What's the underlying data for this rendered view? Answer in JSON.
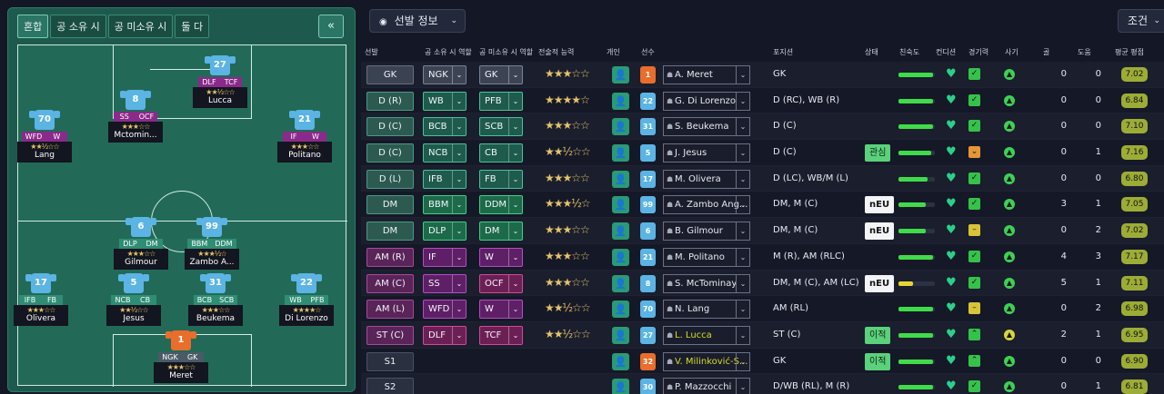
{
  "pitch_panel": {
    "tabs": [
      "혼합",
      "공 소유 시",
      "공 미소유 시",
      "둘 다"
    ],
    "collapse_label": "«",
    "players": [
      {
        "name": "Lucca",
        "number": "27",
        "roles": [
          "DLF",
          "TCF"
        ],
        "stars": "★★½☆☆",
        "gk": false
      },
      {
        "name": "Mctomin...",
        "number": "8",
        "roles": [
          "SS",
          "OCF"
        ],
        "stars": "★★★☆☆",
        "gk": false
      },
      {
        "name": "Lang",
        "number": "70",
        "roles": [
          "WFD",
          "W"
        ],
        "stars": "★★½☆☆",
        "gk": false
      },
      {
        "name": "Politano",
        "number": "21",
        "roles": [
          "IF",
          "W"
        ],
        "stars": "★★★☆☆",
        "gk": false
      },
      {
        "name": "Gilmour",
        "number": "6",
        "roles": [
          "DLP",
          "DM"
        ],
        "stars": "★★★☆☆",
        "gk": false
      },
      {
        "name": "Zambo A...",
        "number": "99",
        "roles": [
          "BBM",
          "DDM"
        ],
        "stars": "★★★½☆",
        "gk": false
      },
      {
        "name": "Olivera",
        "number": "17",
        "roles": [
          "IFB",
          "FB"
        ],
        "stars": "★★★☆☆",
        "gk": false
      },
      {
        "name": "Jesus",
        "number": "5",
        "roles": [
          "NCB",
          "CB"
        ],
        "stars": "★★½☆☆",
        "gk": false
      },
      {
        "name": "Beukema",
        "number": "31",
        "roles": [
          "BCB",
          "SCB"
        ],
        "stars": "★★★☆☆",
        "gk": false
      },
      {
        "name": "Di Lorenzo",
        "number": "22",
        "roles": [
          "WB",
          "PFB"
        ],
        "stars": "★★★★☆",
        "gk": false
      },
      {
        "name": "Meret",
        "number": "1",
        "roles": [
          "NGK",
          "GK"
        ],
        "stars": "★★★☆☆",
        "gk": true
      }
    ]
  },
  "table_panel": {
    "view_select": "선발 정보",
    "view_icon": "eye-icon",
    "filter_select": "조건",
    "headers": {
      "starting": "선발",
      "in_possession": "공 소유 시 역할",
      "out_possession": "공 미소유 시 역할",
      "tactical_ability": "전술적 능력",
      "individual": "개인",
      "player": "선수",
      "position": "포지션",
      "status": "상태",
      "familiarity": "친숙도",
      "condition": "컨디션",
      "match_sharpness": "경기력",
      "morale": "사기",
      "goals": "골",
      "assists": "도움",
      "avg_rating": "평균 평점"
    },
    "rows": [
      {
        "slot": "GK",
        "group": "gk",
        "r1": "NGK",
        "r1c": "gr",
        "r2": "GK",
        "r2c": "gr",
        "stars": "★★★☆☆",
        "num": "1",
        "gk": true,
        "player": "A. Meret",
        "hl": false,
        "position": "GK",
        "status": "",
        "sc": "",
        "fam": 0.95,
        "famc": "g",
        "sharp": "ok",
        "morale": "g",
        "goals": "0",
        "assists": "0",
        "rating": "7.02"
      },
      {
        "slot": "D (R)",
        "group": "def",
        "r1": "WB",
        "r1c": "tl",
        "r2": "PFB",
        "r2c": "tl",
        "stars": "★★★★☆",
        "num": "22",
        "gk": false,
        "player": "G. Di Lorenzo",
        "hl": false,
        "position": "D (RC), WB (R)",
        "status": "",
        "sc": "",
        "fam": 0.95,
        "famc": "g",
        "sharp": "ok",
        "morale": "g",
        "goals": "0",
        "assists": "0",
        "rating": "6.84"
      },
      {
        "slot": "D (C)",
        "group": "def",
        "r1": "BCB",
        "r1c": "tl",
        "r2": "SCB",
        "r2c": "tl",
        "stars": "★★★☆☆",
        "num": "31",
        "gk": false,
        "player": "S. Beukema",
        "hl": false,
        "position": "D (C)",
        "status": "",
        "sc": "",
        "fam": 0.95,
        "famc": "g",
        "sharp": "ok",
        "morale": "g",
        "goals": "0",
        "assists": "0",
        "rating": "7.10"
      },
      {
        "slot": "D (C)",
        "group": "def",
        "r1": "NCB",
        "r1c": "tl",
        "r2": "CB",
        "r2c": "tl",
        "stars": "★★½☆☆",
        "num": "5",
        "gk": false,
        "player": "J. Jesus",
        "hl": false,
        "position": "D (C)",
        "status": "관심",
        "sc": "int",
        "fam": 0.9,
        "famc": "g",
        "sharp": "warn",
        "morale": "g",
        "goals": "0",
        "assists": "1",
        "rating": "7.16"
      },
      {
        "slot": "D (L)",
        "group": "def",
        "r1": "IFB",
        "r1c": "tl",
        "r2": "FB",
        "r2c": "tl",
        "stars": "★★★☆☆",
        "num": "17",
        "gk": false,
        "player": "M. Olivera",
        "hl": false,
        "position": "D (LC), WB/M (L)",
        "status": "",
        "sc": "",
        "fam": 0.8,
        "famc": "g",
        "sharp": "ok",
        "morale": "g",
        "goals": "0",
        "assists": "0",
        "rating": "6.80"
      },
      {
        "slot": "DM",
        "group": "mid",
        "r1": "BBM",
        "r1c": "gn",
        "r2": "DDM",
        "r2c": "gn",
        "stars": "★★★½☆",
        "num": "99",
        "gk": false,
        "player": "A. Zambo Ang...",
        "hl": false,
        "position": "DM, M (C)",
        "status": "nEU",
        "sc": "eu",
        "fam": 0.75,
        "famc": "g",
        "sharp": "ok",
        "morale": "g",
        "goals": "3",
        "assists": "1",
        "rating": "7.05"
      },
      {
        "slot": "DM",
        "group": "mid",
        "r1": "DLP",
        "r1c": "gn",
        "r2": "DM",
        "r2c": "gn",
        "stars": "★★★☆☆",
        "num": "6",
        "gk": false,
        "player": "B. Gilmour",
        "hl": false,
        "position": "DM, M (C)",
        "status": "nEU",
        "sc": "eu",
        "fam": 0.75,
        "famc": "g",
        "sharp": "mid",
        "morale": "g",
        "goals": "0",
        "assists": "2",
        "rating": "7.02"
      },
      {
        "slot": "AM (R)",
        "group": "att",
        "r1": "IF",
        "r1c": "pu",
        "r2": "W",
        "r2c": "pu",
        "stars": "★★★☆☆",
        "num": "21",
        "gk": false,
        "player": "M. Politano",
        "hl": false,
        "position": "M (R), AM (RLC)",
        "status": "",
        "sc": "",
        "fam": 0.95,
        "famc": "g",
        "sharp": "ok",
        "morale": "g",
        "goals": "4",
        "assists": "3",
        "rating": "7.17"
      },
      {
        "slot": "AM (C)",
        "group": "att",
        "r1": "SS",
        "r1c": "pu",
        "r2": "OCF",
        "r2c": "mg",
        "stars": "★★★☆☆",
        "num": "8",
        "gk": false,
        "player": "S. McTominay",
        "hl": false,
        "position": "DM, M (C), AM (LC)",
        "status": "nEU",
        "sc": "eu",
        "fam": 0.4,
        "famc": "y",
        "sharp": "ok",
        "morale": "g",
        "goals": "5",
        "assists": "1",
        "rating": "7.11"
      },
      {
        "slot": "AM (L)",
        "group": "att",
        "r1": "WFD",
        "r1c": "pu",
        "r2": "W",
        "r2c": "pu",
        "stars": "★★½☆☆",
        "num": "70",
        "gk": false,
        "player": "N. Lang",
        "hl": false,
        "position": "AM (RL)",
        "status": "",
        "sc": "",
        "fam": 0.95,
        "famc": "g",
        "sharp": "mid",
        "morale": "g",
        "goals": "0",
        "assists": "2",
        "rating": "6.98"
      },
      {
        "slot": "ST (C)",
        "group": "att",
        "r1": "DLF",
        "r1c": "mg",
        "r2": "TCF",
        "r2c": "mg",
        "stars": "★★½☆☆",
        "num": "27",
        "gk": false,
        "player": "L. Lucca",
        "hl": true,
        "position": "ST (C)",
        "status": "이적",
        "sc": "int",
        "fam": 0.95,
        "famc": "g",
        "sharp": "up",
        "morale": "y",
        "goals": "2",
        "assists": "1",
        "rating": "6.95"
      },
      {
        "slot": "S1",
        "group": "sub",
        "r1": "",
        "r1c": "",
        "r2": "",
        "r2c": "",
        "stars": "",
        "num": "32",
        "gk": true,
        "player": "V. Milinković-S...",
        "hl": true,
        "position": "GK",
        "status": "이적",
        "sc": "int",
        "fam": 0.95,
        "famc": "g",
        "sharp": "up",
        "morale": "g",
        "goals": "0",
        "assists": "0",
        "rating": "6.90"
      },
      {
        "slot": "S2",
        "group": "sub",
        "r1": "",
        "r1c": "",
        "r2": "",
        "r2c": "",
        "stars": "",
        "num": "30",
        "gk": false,
        "player": "P. Mazzocchi",
        "hl": false,
        "position": "D/WB (RL), M (R)",
        "status": "",
        "sc": "",
        "fam": 0.95,
        "famc": "g",
        "sharp": "ok",
        "morale": "g",
        "goals": "0",
        "assists": "1",
        "rating": "6.81"
      }
    ]
  }
}
